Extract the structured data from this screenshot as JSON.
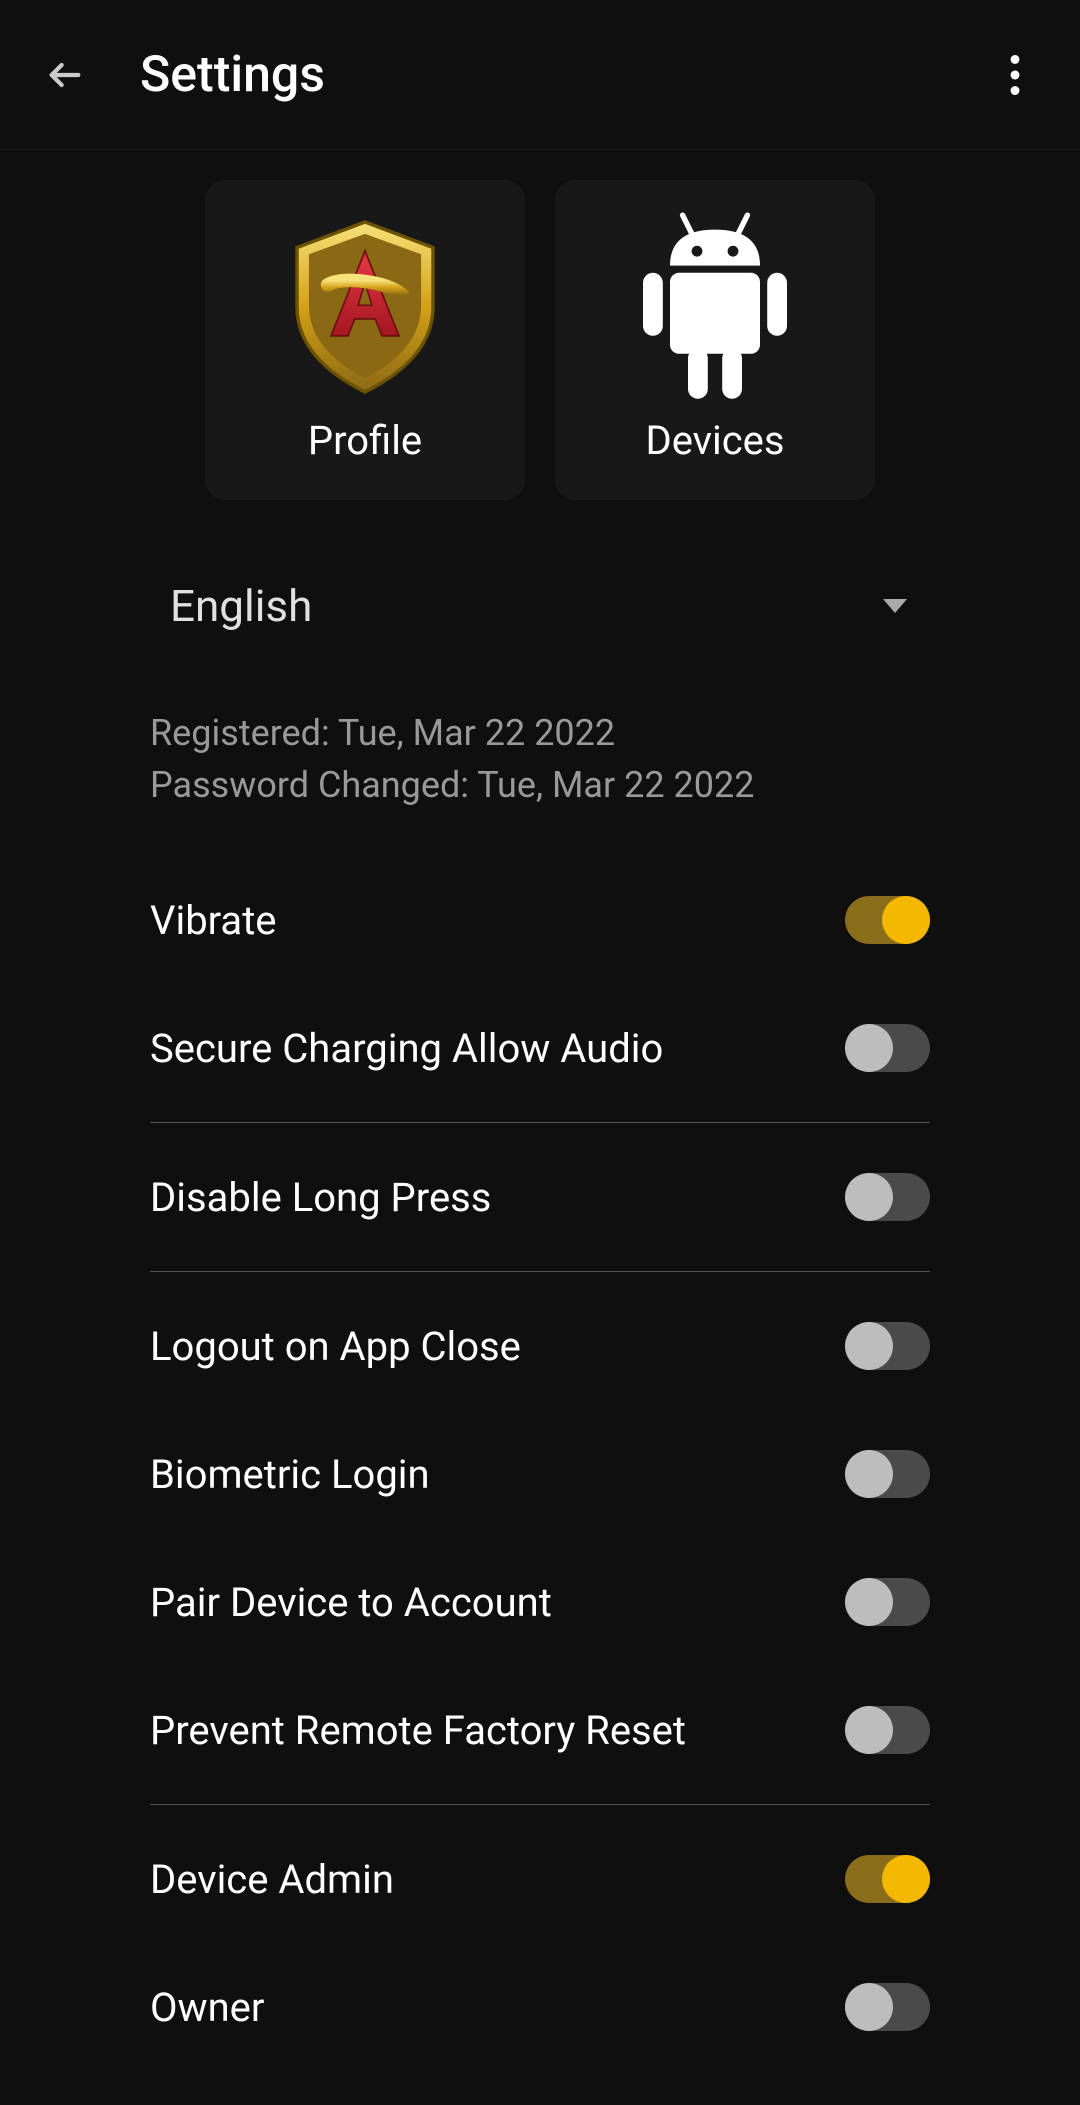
{
  "header": {
    "title": "Settings"
  },
  "cards": {
    "profile": "Profile",
    "devices": "Devices"
  },
  "language": {
    "selected": "English"
  },
  "info": {
    "registered": "Registered: Tue, Mar 22 2022",
    "password_changed": "Password Changed: Tue, Mar 22 2022"
  },
  "settings": {
    "vibrate": {
      "label": "Vibrate",
      "on": true
    },
    "secure_charging": {
      "label": "Secure Charging Allow Audio",
      "on": false
    },
    "disable_long_press": {
      "label": "Disable Long Press",
      "on": false
    },
    "logout_on_close": {
      "label": "Logout on App Close",
      "on": false
    },
    "biometric": {
      "label": "Biometric Login",
      "on": false
    },
    "pair_device": {
      "label": "Pair Device to Account",
      "on": false
    },
    "prevent_reset": {
      "label": "Prevent Remote Factory Reset",
      "on": false
    },
    "device_admin": {
      "label": "Device Admin",
      "on": true
    },
    "owner": {
      "label": "Owner",
      "on": false
    }
  },
  "colors": {
    "accent": "#f5b800",
    "background": "#0f0f0f"
  }
}
